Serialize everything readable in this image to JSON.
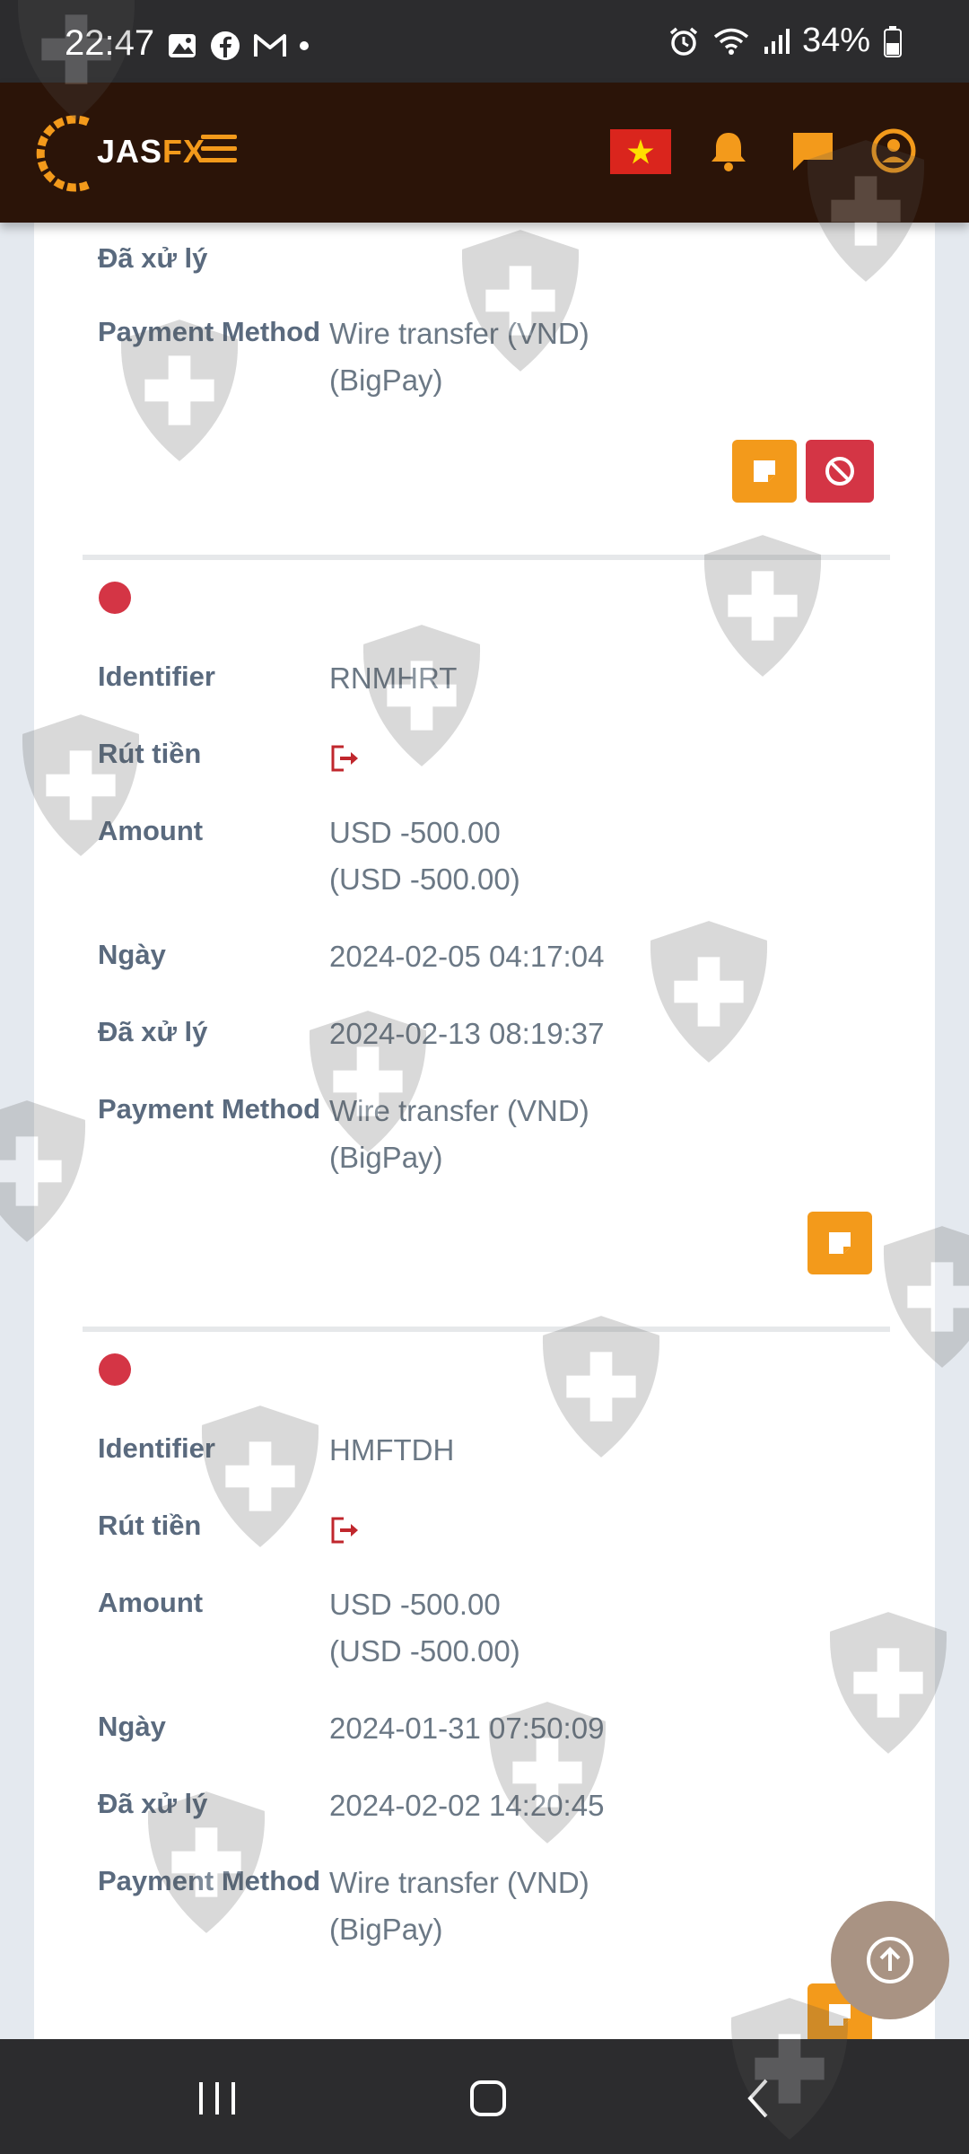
{
  "status_bar": {
    "time": "22:47",
    "battery": "34%",
    "icons_left": [
      "gallery-icon",
      "facebook-icon",
      "gmail-icon"
    ],
    "icons_right": [
      "alarm-icon",
      "wifi-icon",
      "signal-icon",
      "battery-icon"
    ]
  },
  "header": {
    "logo_jas": "JAS",
    "logo_fx": "FX",
    "icons": [
      "menu-icon",
      "vietnam-flag-icon",
      "bell-icon",
      "chat-icon",
      "user-icon"
    ],
    "accent": "#f39a1b",
    "background": "#2b1408"
  },
  "labels": {
    "processed": "Đã xử lý",
    "payment_method": "Payment Method",
    "identifier": "Identifier",
    "withdraw": "Rút tiền",
    "amount": "Amount",
    "date": "Ngày"
  },
  "transactions": [
    {
      "payment_method_line1": "Wire transfer (VND)",
      "payment_method_line2": "(BigPay)"
    },
    {
      "identifier": "RNMHRT",
      "amount_line1": "USD -500.00",
      "amount_line2": "(USD -500.00)",
      "date": "2024-02-05 04:17:04",
      "processed": "2024-02-13 08:19:37",
      "payment_method_line1": "Wire transfer (VND)",
      "payment_method_line2": "(BigPay)"
    },
    {
      "identifier": "HMFTDH",
      "amount_line1": "USD -500.00",
      "amount_line2": "(USD -500.00)",
      "date": "2024-01-31 07:50:09",
      "processed": "2024-02-02 14:20:45",
      "payment_method_line1": "Wire transfer (VND)",
      "payment_method_line2": "(BigPay)"
    }
  ],
  "colors": {
    "status_dot": "#d43545",
    "note_button": "#f39a1b",
    "cancel_button": "#d43545"
  }
}
